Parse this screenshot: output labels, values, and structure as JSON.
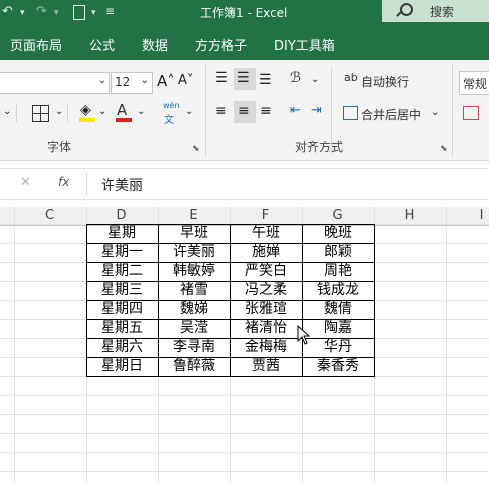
{
  "window": {
    "title": "工作簿1  -  Excel",
    "search_label": "搜索"
  },
  "menu": [
    "页面布局",
    "公式",
    "数据",
    "方方格子",
    "DIY工具箱"
  ],
  "ribbon": {
    "font_size": "12",
    "grow_font": "A˄",
    "shrink_font": "A˅",
    "wen_label": "wén",
    "wen_char": "文",
    "wrap_text": "自动换行",
    "merge_center": "合并后居中",
    "number_format": "常规",
    "font_group": "字体",
    "align_group": "对齐方式",
    "ab_label": "ab"
  },
  "formula_bar": {
    "fx": "fx",
    "value": "许美丽"
  },
  "columns": [
    "C",
    "D",
    "E",
    "F",
    "G",
    "H",
    "I"
  ],
  "table": {
    "header": [
      "星期",
      "早班",
      "午班",
      "晚班"
    ],
    "rows": [
      [
        "星期一",
        "许美丽",
        "施婵",
        "郎颖"
      ],
      [
        "星期二",
        "韩敏婷",
        "严笑白",
        "周艳"
      ],
      [
        "星期三",
        "褚雪",
        "冯之柔",
        "钱成龙"
      ],
      [
        "星期四",
        "魏娣",
        "张雅瑄",
        "魏倩"
      ],
      [
        "星期五",
        "吴滢",
        "褚清怡",
        "陶嘉"
      ],
      [
        "星期六",
        "李寻南",
        "金梅梅",
        "华丹"
      ],
      [
        "星期日",
        "鲁醉薇",
        "贾茜",
        "秦香秀"
      ]
    ]
  }
}
